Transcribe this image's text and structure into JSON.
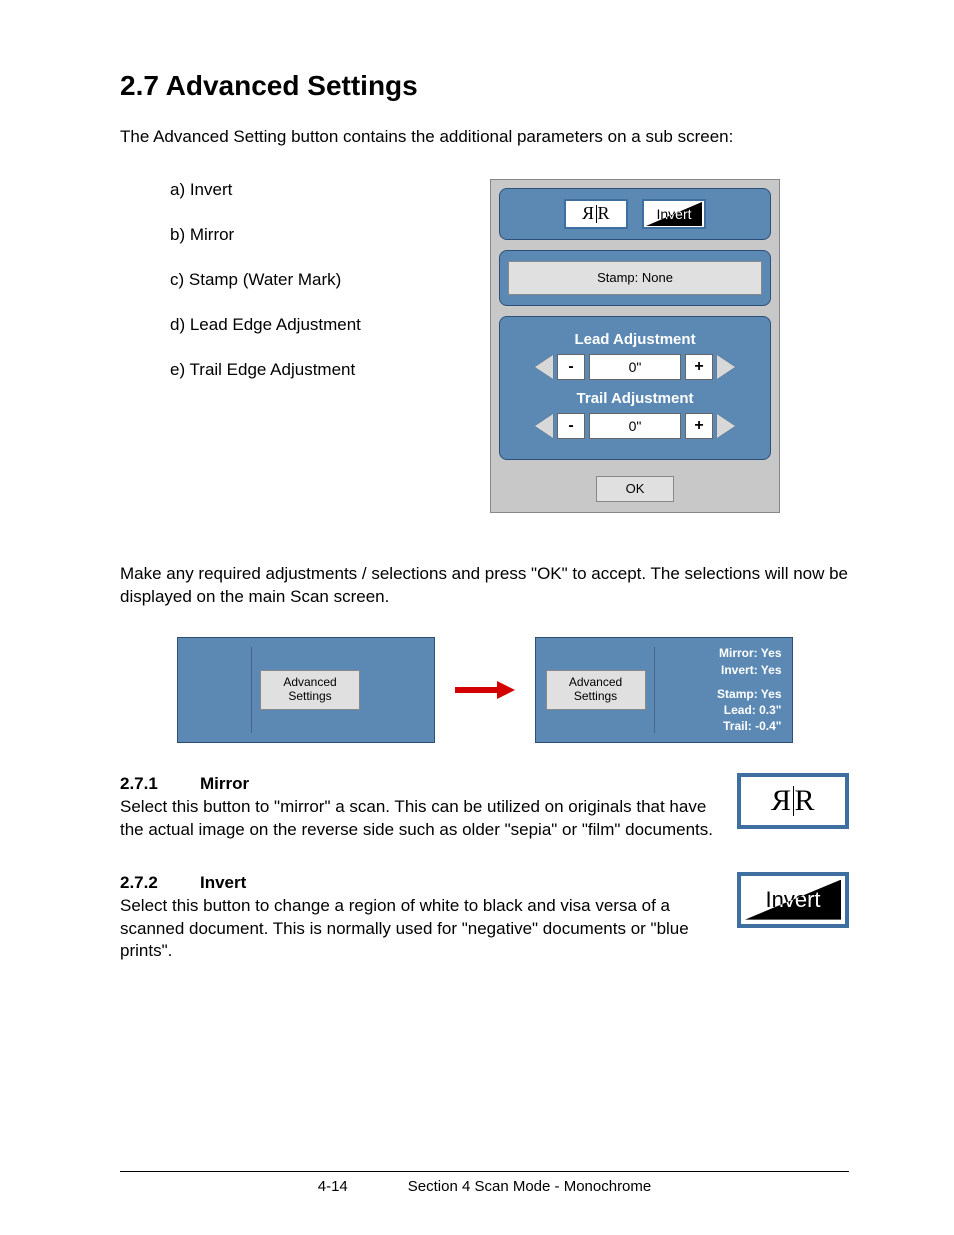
{
  "heading": "2.7  Advanced Settings",
  "intro": "The Advanced Setting button contains the additional parameters on a sub screen:",
  "features": [
    "a)  Invert",
    "b)  Mirror",
    "c)  Stamp (Water Mark)",
    "d)  Lead Edge Adjustment",
    "e)  Trail Edge Adjustment"
  ],
  "dialog": {
    "mirror_label": "ЯR",
    "invert_label": "Invert",
    "stamp_label": "Stamp: None",
    "lead_title": "Lead Adjustment",
    "lead_value": "0\"",
    "trail_title": "Trail Adjustment",
    "trail_value": "0\"",
    "minus": "-",
    "plus": "+",
    "ok": "OK"
  },
  "after_text": "Make any required adjustments / selections and press \"OK\" to accept. The selections will now be displayed on the main Scan screen.",
  "mini": {
    "advanced_line1": "Advanced",
    "advanced_line2": "Settings",
    "status": {
      "mirror": "Mirror: Yes",
      "invert": "Invert: Yes",
      "stamp": "Stamp: Yes",
      "lead": "Lead: 0.3\"",
      "trail": "Trail: -0.4\""
    }
  },
  "s271": {
    "num": "2.7.1",
    "title": "Mirror",
    "body": "Select this button to \"mirror\" a scan. This can be utilized on originals that have the actual image on the reverse side such as older \"sepia\" or \"film\" documents."
  },
  "s272": {
    "num": "2.7.2",
    "title": "Invert",
    "body": "Select this button to change a region of white to black and visa versa of a scanned document. This is normally used for \"negative\" documents or \"blue prints\"."
  },
  "footer": {
    "page": "4-14",
    "section": "Section 4     Scan Mode - Monochrome"
  }
}
